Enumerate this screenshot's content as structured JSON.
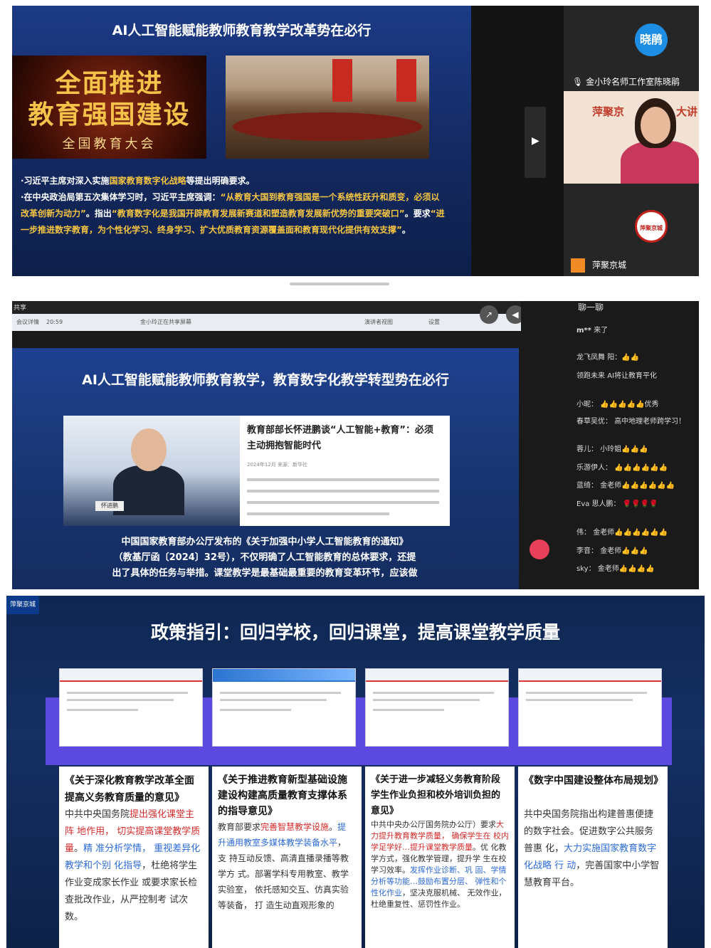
{
  "panel1": {
    "slide_title": "AI人工智能赋能教师教育教学改革势在必行",
    "banner": {
      "line1": "全面推进",
      "line2": "教育强国建设",
      "line3": "全国教育大会"
    },
    "bullet1_prefix": "·习近平主席对深入实施",
    "bullet1_highlight": "国家教育数字化战略",
    "bullet1_suffix": "等提出明确要求。",
    "bullet2_prefix": "·在中央政治局第五次集体学习时，习近平主席强调：",
    "bullet2_q1": "“从教育大国到教育强国是一个系统性跃升和质变，必须以改革创新为动力”",
    "bullet2_mid": "。指出",
    "bullet2_q2": "“教育数字化是我国开辟教育发展新赛道和塑造教育发展新优势的重要突破口”",
    "bullet2_mid2": "。要求",
    "bullet2_q3": "“进一步推进数字教育，为个性化学习、终身学习、扩大优质教育资源覆盖面和教育现代化提供有效支撑”",
    "bullet2_end": "。",
    "avatar_text": "晓鹃",
    "participant1": "金小玲名师工作室陈晓鹃",
    "cam_bg_left": "萍聚京",
    "cam_bg_right": "大讲",
    "logo_text": "萍聚京城",
    "participant2": "萍聚京城"
  },
  "panel2": {
    "topbar_text": "共享",
    "window_bar": {
      "a": "会议详情",
      "b": "20:59",
      "c": "金小玲正在共享屏幕",
      "d": "演讲者视图",
      "e": "设置"
    },
    "slide_title": "AI人工智能赋能教师教育教学，教育数字化教学转型势在必行",
    "news_headline": "教育部部长怀进鹏谈“人工智能+教育”：必须主动拥抱智能时代",
    "news_meta": "2024年12月  来源：新华社",
    "nameplate": "怀进鹏",
    "para_line1": "中国国家教育部办公厅发布的《关于加强中小学人工智能教育的通知》",
    "para_line2": "（教基厅函〔2024〕32号），不仅明确了人工智能教育的总体要求，还提",
    "para_line3": "出了具体的任务与举措。课堂教学是最基础最重要的教育变革环节，应该做",
    "chat_header": "聊一聊",
    "chat": [
      {
        "name": "m**",
        "text": "来了"
      },
      {
        "name": "龙飞凤舞",
        "text": "阳：👍👍"
      },
      {
        "name": "领跑未来",
        "text": "AI将让教育平化"
      },
      {
        "name": "小昵：",
        "text": "👍👍👍👍👍优秀"
      },
      {
        "name": "春草吴优：",
        "text": "高中地理老师跨学习！"
      },
      {
        "name": "蓉儿：",
        "text": "小玲姐👍👍👍"
      },
      {
        "name": "乐游伊人：",
        "text": "👍👍👍👍👍👍"
      },
      {
        "name": "蓝绮：",
        "text": "金老师👍👍👍👍👍👍"
      },
      {
        "name": "Eva 思人鹏：",
        "text": "🌹🌹🌹🌹"
      },
      {
        "name": "伟：",
        "text": "金老师👍👍👍👍👍👍"
      },
      {
        "name": "李音：",
        "text": "金老师👍👍👍"
      },
      {
        "name": "sky：",
        "text": "金老师👍👍👍👍"
      }
    ]
  },
  "panel3": {
    "logo": "萍聚京城",
    "title": "政策指引：回归学校，回归课堂，提高课堂教学质量",
    "box1": {
      "heading": "《关于深化教育教学改革全面提高义务教育质量的意见》",
      "t1": "中共中央国务院",
      "r1": "提出强化课堂主阵 地作用， 切实提高课堂教学质量",
      "t2": "。",
      "b1": "精 准分析学情， 重视差异化教学和个别 化指导",
      "t3": "，杜绝将学生作业变成家长作业 或要求家长检查批改作业，从严控制考 试次数。"
    },
    "box2": {
      "heading": "《关于推进教育新型基础设施建设构建高质量教育支撑体系的指导意见》",
      "t1": "教育部要求",
      "r1": "完善智慧教学设施",
      "t2": "。",
      "b1": "提 升通用教室多媒体教学装备水平",
      "t3": "， 支 持互动反馈、高清直播录播等教学方 式。部署学科专用教室、教学实验室， 依托感知交互、仿真实验等装备， 打 造生动直观形象的"
    },
    "box3": {
      "heading": "《关于进一步减轻义务教育阶段学生作业负担和校外培训负担的意见》",
      "t1": "中共中央办公厅国务院办公厅）要求",
      "r1": "大力提升教育教学质量， 确保学生在 校内学足学好…提升课堂教学质量",
      "t2": "。优 化教学方式，强化教学管理，提升学 生在校学习效率。",
      "b1": "发挥作业诊断、巩 固、学情分析等功能…鼓励布置分层、 弹性和个性化作业",
      "t3": "，坚决克服机械、 无效作业，杜绝重复性、惩罚性作业。"
    },
    "box4": {
      "heading": "《数字中国建设整体布局规划》",
      "t1": "共中央国务院指出构建普惠便捷 的数字社会。促进数字公共服务普惠 化，",
      "b1": "大力实施国家教育数字化战略 行 动",
      "t2": "，完善国家中小学智慧教育平台。"
    }
  }
}
